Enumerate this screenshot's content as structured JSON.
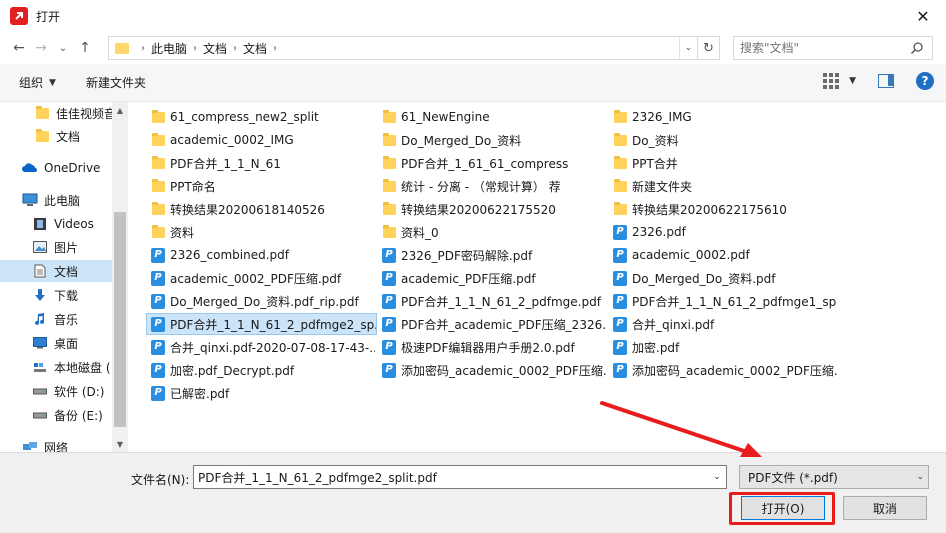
{
  "window": {
    "title": "打开",
    "close_label": "✕"
  },
  "nav": {
    "back": "←",
    "forward": "→",
    "recent": "⌄",
    "up": "↑",
    "breadcrumb": [
      "此电脑",
      "文档",
      "文档"
    ],
    "refresh": "↻",
    "search_placeholder": "搜索\"文档\""
  },
  "toolbar": {
    "organize_label": "组织",
    "new_folder_label": "新建文件夹"
  },
  "sidebar": {
    "items": [
      {
        "label": "佳佳视频音",
        "icon": "folder-icon"
      },
      {
        "label": "文档",
        "icon": "folder-icon"
      },
      {
        "label": "OneDrive",
        "icon": "cloud-icon"
      },
      {
        "label": "此电脑",
        "icon": "computer-icon"
      },
      {
        "label": "Videos",
        "icon": "video-icon"
      },
      {
        "label": "图片",
        "icon": "picture-icon"
      },
      {
        "label": "文档",
        "icon": "document-icon",
        "selected": true
      },
      {
        "label": "下载",
        "icon": "download-icon"
      },
      {
        "label": "音乐",
        "icon": "music-icon"
      },
      {
        "label": "桌面",
        "icon": "desktop-icon"
      },
      {
        "label": "本地磁盘 (",
        "icon": "disk-icon"
      },
      {
        "label": "软件 (D:)",
        "icon": "drive-icon"
      },
      {
        "label": "备份 (E:)",
        "icon": "drive-icon"
      },
      {
        "label": "网络",
        "icon": "network-icon"
      }
    ]
  },
  "files": {
    "col1": [
      {
        "name": "61_compress_new2_split",
        "type": "folder"
      },
      {
        "name": "academic_0002_IMG",
        "type": "folder"
      },
      {
        "name": "PDF合并_1_1_N_61",
        "type": "folder"
      },
      {
        "name": "PPT命名",
        "type": "folder"
      },
      {
        "name": "转换结果20200618140526",
        "type": "folder"
      },
      {
        "name": "资料",
        "type": "folder"
      },
      {
        "name": "2326_combined.pdf",
        "type": "pdf"
      },
      {
        "name": "academic_0002_PDF压缩.pdf",
        "type": "pdf"
      },
      {
        "name": "Do_Merged_Do_资料.pdf_rip.pdf",
        "type": "pdf"
      },
      {
        "name": "PDF合并_1_1_N_61_2_pdfmge2_sp...",
        "type": "pdf",
        "selected": true
      },
      {
        "name": "合并_qinxi.pdf-2020-07-08-17-43-...",
        "type": "pdf"
      },
      {
        "name": "加密.pdf_Decrypt.pdf",
        "type": "pdf"
      },
      {
        "name": "已解密.pdf",
        "type": "pdf"
      }
    ],
    "col2": [
      {
        "name": "61_NewEngine",
        "type": "folder"
      },
      {
        "name": "Do_Merged_Do_资料",
        "type": "folder"
      },
      {
        "name": "PDF合并_1_61_61_compress",
        "type": "folder"
      },
      {
        "name": "统计 - 分离 - （常规计算） 荐",
        "type": "folder"
      },
      {
        "name": "转换结果20200622175520",
        "type": "folder"
      },
      {
        "name": "资料_0",
        "type": "folder"
      },
      {
        "name": "2326_PDF密码解除.pdf",
        "type": "pdf"
      },
      {
        "name": "academic_PDF压缩.pdf",
        "type": "pdf"
      },
      {
        "name": "PDF合并_1_1_N_61_2_pdfmge.pdf",
        "type": "pdf"
      },
      {
        "name": "PDF合并_academic_PDF压缩_2326....",
        "type": "pdf"
      },
      {
        "name": "极速PDF编辑器用户手册2.0.pdf",
        "type": "pdf"
      },
      {
        "name": "添加密码_academic_0002_PDF压缩...",
        "type": "pdf"
      }
    ],
    "col3": [
      {
        "name": "2326_IMG",
        "type": "folder"
      },
      {
        "name": "Do_资料",
        "type": "folder"
      },
      {
        "name": "PPT合并",
        "type": "folder"
      },
      {
        "name": "新建文件夹",
        "type": "folder"
      },
      {
        "name": "转换结果20200622175610",
        "type": "folder"
      },
      {
        "name": "2326.pdf",
        "type": "pdf"
      },
      {
        "name": "academic_0002.pdf",
        "type": "pdf"
      },
      {
        "name": "Do_Merged_Do_资料.pdf",
        "type": "pdf"
      },
      {
        "name": "PDF合并_1_1_N_61_2_pdfmge1_sp...",
        "type": "pdf"
      },
      {
        "name": "合并_qinxi.pdf",
        "type": "pdf"
      },
      {
        "name": "加密.pdf",
        "type": "pdf"
      },
      {
        "name": "添加密码_academic_0002_PDF压缩..",
        "type": "pdf"
      }
    ]
  },
  "bottom": {
    "filename_label": "文件名(N):",
    "filename_value": "PDF合并_1_1_N_61_2_pdfmge2_split.pdf",
    "filetype_value": "PDF文件 (*.pdf)",
    "open_label": "打开(O)",
    "cancel_label": "取消"
  },
  "colors": {
    "accent": "#0078d7",
    "selection": "#cce4f7",
    "annotation": "#e81c1c",
    "folder": "#ffd25c",
    "pdf": "#2a8ee0"
  }
}
